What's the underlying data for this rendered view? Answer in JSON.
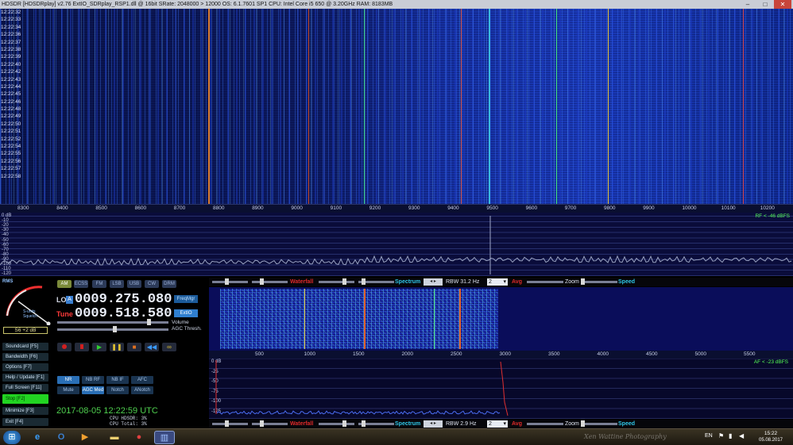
{
  "window": {
    "title": "HDSDR  [HDSDRplay]   v2.76     ExtIO_SDRplay_RSP1.dll @ 16bit    SRate: 2048000 > 12000    OS: 6.1.7601 SP1    CPU: Intel Core i5       650  @ 3.20GHz    RAM: 8183MB",
    "min": "–",
    "max": "□",
    "close": "✕"
  },
  "waterfall_times": [
    "12:22:32",
    "12:22:33",
    "12:22:34",
    "12:22:36",
    "12:22:37",
    "12:22:38",
    "12:22:39",
    "12:22:40",
    "12:22:42",
    "12:22:43",
    "12:22:44",
    "12:22:45",
    "12:22:46",
    "12:22:48",
    "12:22:49",
    "12:22:50",
    "12:22:51",
    "12:22:52",
    "12:22:54",
    "12:22:55",
    "12:22:56",
    "12:22:57",
    "12:22:58"
  ],
  "freq_scale": [
    "8300",
    "8400",
    "8500",
    "8600",
    "8700",
    "8800",
    "8900",
    "9000",
    "9100",
    "9200",
    "9300",
    "9400",
    "9500",
    "9600",
    "9700",
    "9800",
    "9900",
    "10000",
    "10100",
    "10200"
  ],
  "spectrum": {
    "db_labels": [
      "0 dB",
      "-10",
      "-20",
      "-30",
      "-40",
      "-50",
      "-60",
      "-70",
      "-80",
      "-90",
      "-100",
      "-110",
      "-120"
    ],
    "rf_readout": "RF < -46 dBFS"
  },
  "toolbar": {
    "waterfall_label": "Waterfall",
    "spectrum_label": "Spectrum",
    "rbw_label": "RBW 31.2 Hz",
    "rbw_label_af": "RBW 2.9 Hz",
    "avg_label": "Avg",
    "avg_value": "2",
    "zoom_label": "Zoom",
    "speed_label": "Speed"
  },
  "modes": [
    "AM",
    "ECSS",
    "FM",
    "LSB",
    "USB",
    "CW",
    "DRM"
  ],
  "meter": {
    "rms_label": "RMS",
    "signal_label": "S-units",
    "squelch": "Squelch",
    "reading": "S6 +2 dB",
    "scale": [
      "1",
      "3",
      "5",
      "7",
      "9",
      "+20",
      "+40"
    ]
  },
  "frequency": {
    "lo_label": "LO",
    "lo_mode": "A",
    "lo_value": "0009.275.080",
    "tune_label": "Tune",
    "tune_value": "0009.518.580"
  },
  "right_buttons": {
    "freqmgr": "FreqMgr",
    "extio": "ExtIO",
    "volume": "Volume",
    "agc": "AGC Thresh."
  },
  "side_buttons": [
    "Soundcard [F5]",
    "Bandwidth [F6]",
    "Options [F7]",
    "Help / Update [F1]",
    "Full Screen [F11]",
    "Stop [F2]",
    "Minimize [F3]",
    "Exit [F4]"
  ],
  "nr_buttons": [
    "NR",
    "NB RF",
    "NB IF",
    "AFC",
    "Mute",
    "AGC Med",
    "Notch",
    "ANotch"
  ],
  "status": {
    "datetime": "2017-08-05  12:22:59 UTC",
    "cpu_hdsdr": "CPU HDSDR:  3%",
    "cpu_total": "CPU Total:  3%"
  },
  "af_scale": [
    "500",
    "1000",
    "1500",
    "2000",
    "2500",
    "3000",
    "3500",
    "4000",
    "4500",
    "5000",
    "5500"
  ],
  "af_spectrum": {
    "db_labels": [
      "0 dB",
      "-25",
      "-50",
      "-75",
      "-100",
      "-125"
    ],
    "af_readout": "AF < -23 dBFS"
  },
  "taskbar": {
    "lang": "EN",
    "time": "15:22",
    "date": "05.08.2017",
    "watermark": "Xen Wattine Photography"
  },
  "colors": {
    "accent_green": "#22d422",
    "waterfall_bg": "#0b1650"
  }
}
